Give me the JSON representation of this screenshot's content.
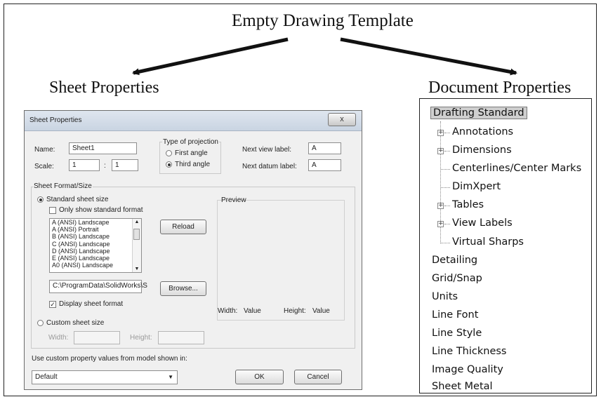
{
  "figure": {
    "title": "Empty Drawing Template",
    "left_heading": "Sheet Properties",
    "right_heading": "Document Properties"
  },
  "dialog": {
    "title": "Sheet Properties",
    "close_label": "x",
    "name_label": "Name:",
    "name_value": "Sheet1",
    "scale_label": "Scale:",
    "scale_num": "1",
    "scale_colon": ":",
    "scale_den": "1",
    "projection_group": "Type of projection",
    "first_angle": "First angle",
    "third_angle": "Third angle",
    "selected_projection": "Third angle",
    "next_view_label": "Next view label:",
    "next_view_value": "A",
    "next_datum_label": "Next datum label:",
    "next_datum_value": "A",
    "format_group": "Sheet Format/Size",
    "standard_size": "Standard sheet size",
    "only_standard": "Only show standard format",
    "only_standard_checked": false,
    "sizes": [
      "A (ANSI) Landscape",
      "A (ANSI) Portrait",
      "B (ANSI) Landscape",
      "C (ANSI) Landscape",
      "D (ANSI) Landscape",
      "E (ANSI) Landscape",
      "A0 (ANSI) Landscape"
    ],
    "reload": "Reload",
    "path_value": "C:\\ProgramData\\SolidWorks\\S",
    "browse": "Browse...",
    "display_format": "Display sheet format",
    "display_format_checked": true,
    "preview_label": "Preview",
    "width_label": "Width:",
    "width_value": "Value",
    "height_label": "Height:",
    "height_value": "Value",
    "custom_size": "Custom sheet size",
    "custom_width_label": "Width:",
    "custom_height_label": "Height:",
    "use_custom": "Use custom property values from model shown in:",
    "model_select": "Default",
    "ok": "OK",
    "cancel": "Cancel"
  },
  "tree": {
    "root": "Drafting Standard",
    "children": [
      "Annotations",
      "Dimensions",
      "Centerlines/Center Marks",
      "DimXpert",
      "Tables",
      "View Labels",
      "Virtual Sharps"
    ],
    "sections": [
      "Detailing",
      "Grid/Snap",
      "Units",
      "Line Font",
      "Line Style",
      "Line Thickness",
      "Image Quality",
      "Sheet Metal"
    ]
  }
}
